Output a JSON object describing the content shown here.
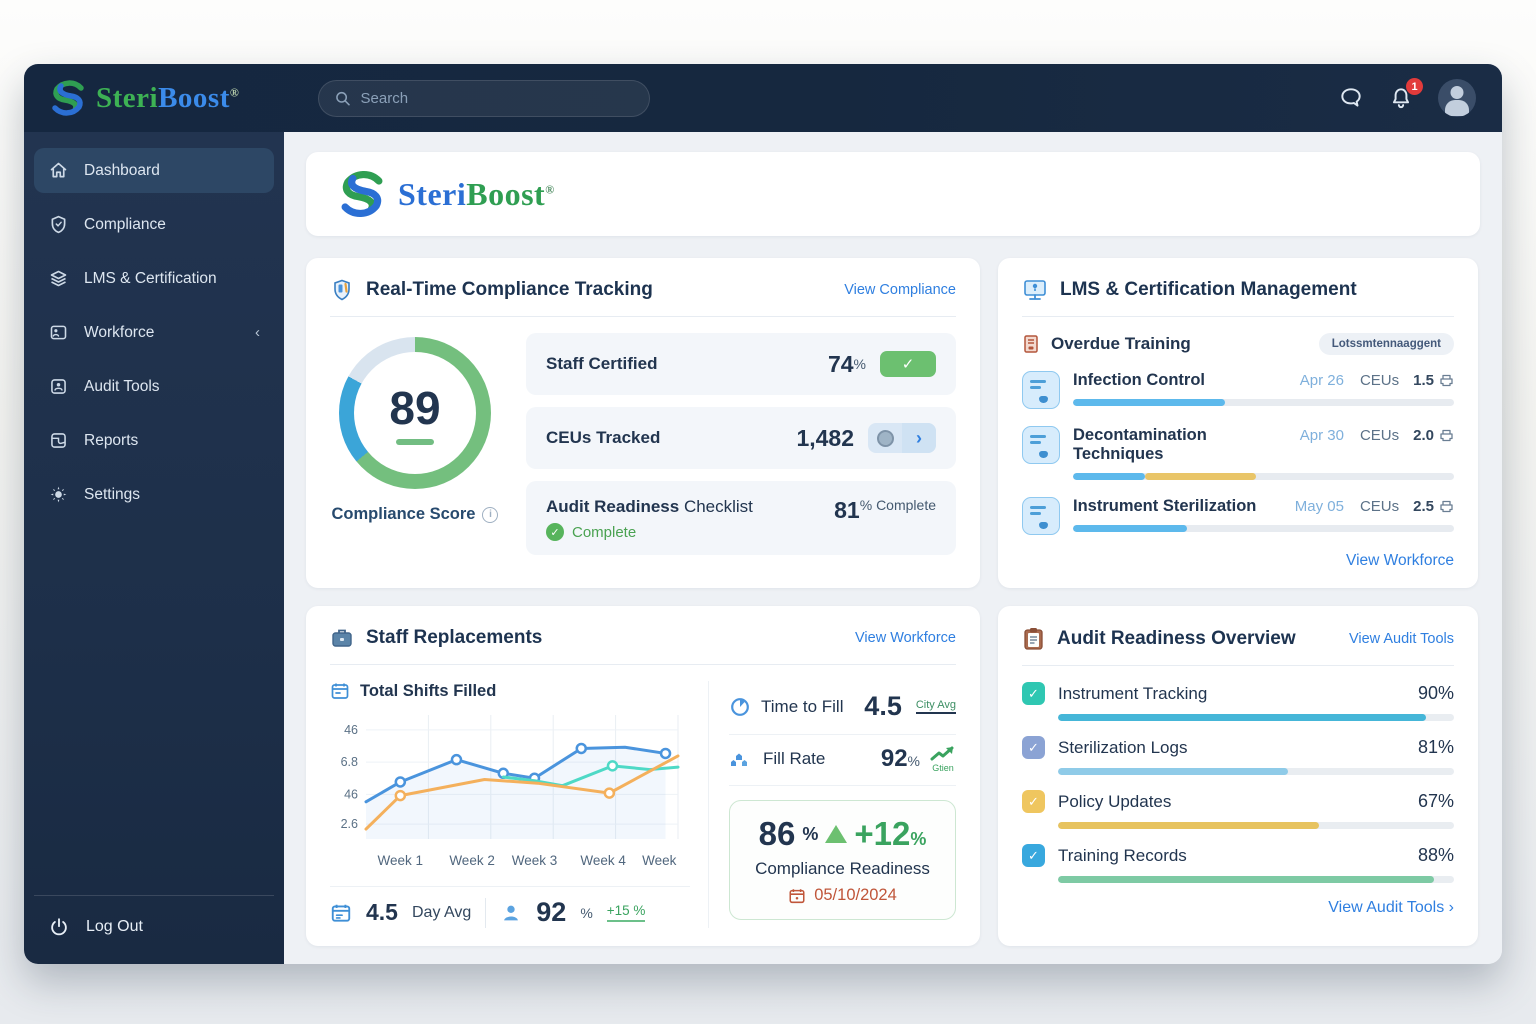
{
  "header": {
    "logo_steri": "Steri",
    "logo_boost": "Boost",
    "logo_reg": "®",
    "search_placeholder": "Search",
    "notification_count": "1"
  },
  "sidebar": {
    "items": [
      {
        "label": "Dashboard"
      },
      {
        "label": "Compliance"
      },
      {
        "label": "LMS & Certification"
      },
      {
        "label": "Workforce",
        "chevron": "‹"
      },
      {
        "label": "Audit Tools"
      },
      {
        "label": "Reports"
      },
      {
        "label": "Settings"
      }
    ],
    "logout_label": "Log Out"
  },
  "brand_card": {
    "steri": "Steri",
    "boost": "Boost",
    "reg": "®"
  },
  "icons": {
    "check": "✓",
    "chevron_right": "›",
    "info": "i"
  },
  "compliance_card": {
    "title": "Real-Time Compliance Tracking",
    "link": "View Compliance",
    "score": "89",
    "score_label": "Compliance Score",
    "gauge_segments": [
      {
        "color": "#74bf7e",
        "pct": 64
      },
      {
        "color": "#3ba5d8",
        "pct": 19
      },
      {
        "color": "#d9e4ef",
        "pct": 17
      }
    ],
    "rows": {
      "staff_certified": {
        "label": "Staff Certified",
        "value": "74",
        "suffix": "%"
      },
      "ceus_tracked": {
        "label": "CEUs Tracked",
        "value": "1,482"
      },
      "audit_readiness": {
        "label": "Audit Readiness",
        "label2": "Checklist",
        "value": "81",
        "suffix": "% Complete",
        "status": "Complete"
      }
    }
  },
  "lms_card": {
    "title": "LMS & Certification Management",
    "section_title": "Overdue Training",
    "badge": "Lotssmtennaaggent",
    "items": [
      {
        "name": "Infection Control",
        "date": "Apr 26",
        "ceu_label": "CEUs",
        "ceu": "1.5",
        "bar": [
          {
            "color": "#5db9ec",
            "pct": 40
          }
        ]
      },
      {
        "name": "Decontamination Techniques",
        "date": "Apr 30",
        "ceu_label": "CEUs",
        "ceu": "2.0",
        "bar": [
          {
            "color": "#5db9ec",
            "pct": 19
          },
          {
            "color": "#e9c568",
            "pct": 29
          }
        ]
      },
      {
        "name": "Instrument Sterilization",
        "date": "May 05",
        "ceu_label": "CEUs",
        "ceu": "2.5",
        "bar": [
          {
            "color": "#5db9ec",
            "pct": 30
          }
        ]
      }
    ],
    "link": "View Workforce"
  },
  "staff_card": {
    "title": "Staff Replacements",
    "link": "View Workforce",
    "chart_title": "Total Shifts Filled",
    "day_avg": "4.5",
    "day_avg_label": "Day Avg",
    "fill_pct": "92",
    "fill_pct_suffix": "%",
    "fill_delta": "+15 %",
    "time_to_fill_label": "Time to Fill",
    "time_to_fill_value": "4.5",
    "time_to_fill_note": "City Avg",
    "fill_rate_label": "Fill Rate",
    "fill_rate_value": "92",
    "fill_rate_suffix": "%",
    "fill_rate_note": "Gtien",
    "readiness": {
      "value": "86",
      "suffix": "%",
      "delta": "+12",
      "delta_suffix": "%",
      "label": "Compliance Readiness",
      "date": "05/10/2024"
    }
  },
  "chart_data": {
    "type": "line",
    "title": "Total Shifts Filled",
    "y_ticks": [
      {
        "label": "46",
        "pos": 88
      },
      {
        "label": "6.8",
        "pos": 62
      },
      {
        "label": "46",
        "pos": 36
      },
      {
        "label": "2.6",
        "pos": 12
      }
    ],
    "x_ticks": [
      {
        "label": "Week 1",
        "pos": 11
      },
      {
        "label": "Week 2",
        "pos": 34
      },
      {
        "label": "Week 3",
        "pos": 54
      },
      {
        "label": "Week 4",
        "pos": 76
      },
      {
        "label": "Week",
        "pos": 94
      }
    ],
    "grid": true,
    "series": [
      {
        "name": "blue",
        "color": "#4a94dd",
        "area": true,
        "points": [
          [
            0,
            30
          ],
          [
            11,
            46
          ],
          [
            29,
            64
          ],
          [
            44,
            53
          ],
          [
            54,
            49
          ],
          [
            69,
            73
          ],
          [
            83,
            74
          ],
          [
            96,
            69
          ]
        ],
        "markers": [
          1,
          2,
          3,
          4,
          5,
          7
        ]
      },
      {
        "name": "teal",
        "color": "#4ed9c6",
        "area": false,
        "points": [
          [
            44,
            50
          ],
          [
            54,
            47
          ],
          [
            63,
            43
          ],
          [
            79,
            59
          ],
          [
            91,
            56
          ],
          [
            100,
            58
          ]
        ],
        "markers": [
          3
        ]
      },
      {
        "name": "orange",
        "color": "#f4b05c",
        "area": false,
        "points": [
          [
            0,
            8
          ],
          [
            11,
            35
          ],
          [
            38,
            48
          ],
          [
            55,
            45
          ],
          [
            78,
            37
          ],
          [
            100,
            67
          ]
        ],
        "markers": [
          1,
          4
        ]
      }
    ]
  },
  "audit_card": {
    "title": "Audit Readiness Overview",
    "link_top": "View Audit Tools",
    "rows": [
      {
        "label": "Instrument Tracking",
        "value": "90%",
        "check_color": "#2fc7b2",
        "bar_color": "#45b6d8",
        "bar_pct": 93
      },
      {
        "label": "Sterilization Logs",
        "value": "81%",
        "check_color": "#8ba3d4",
        "bar_color": "#8fcbe8",
        "bar_pct": 58
      },
      {
        "label": "Policy Updates",
        "value": "67%",
        "check_color": "#efc65f",
        "bar_color": "#e7c35f",
        "bar_pct": 66
      },
      {
        "label": "Training Records",
        "value": "88%",
        "check_color": "#38a8de",
        "bar_color": "#7ecaa4",
        "bar_pct": 95
      }
    ],
    "link_bottom": "View Audit Tools ›"
  }
}
